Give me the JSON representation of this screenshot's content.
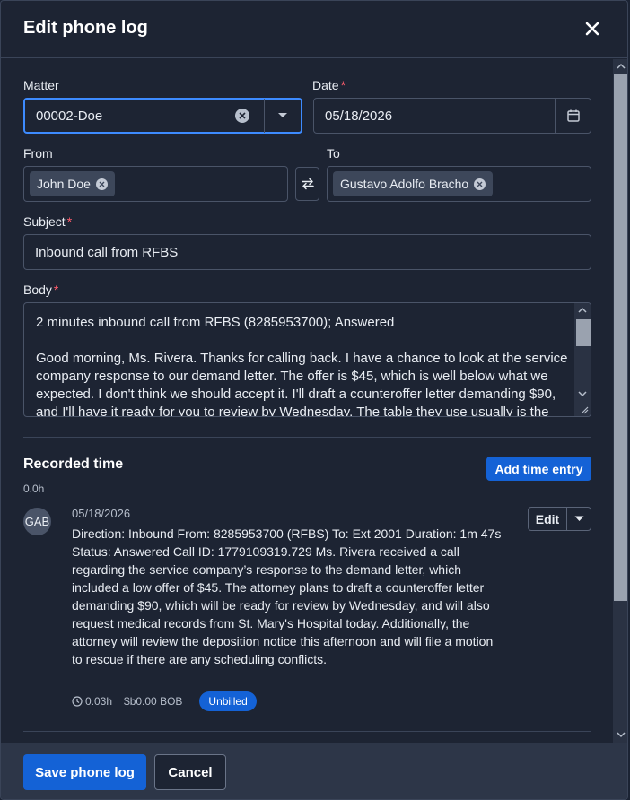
{
  "modal": {
    "title": "Edit phone log",
    "close_icon": "close-icon"
  },
  "form": {
    "matter": {
      "label": "Matter",
      "value": "00002-Doe"
    },
    "date": {
      "label": "Date",
      "required_mark": "*",
      "value": "05/18/2026"
    },
    "from": {
      "label": "From",
      "chips": [
        "John Doe"
      ]
    },
    "to": {
      "label": "To",
      "chips": [
        "Gustavo Adolfo Bracho"
      ]
    },
    "subject": {
      "label": "Subject",
      "required_mark": "*",
      "value": "Inbound call from RFBS"
    },
    "body": {
      "label": "Body",
      "required_mark": "*",
      "value": "2 minutes inbound call from RFBS (8285953700); Answered\n\nGood morning, Ms. Rivera. Thanks for calling back. I have a chance to look at the service company response to our demand letter. The offer is $45, which is well below what we expected. I don't think we should accept it. I'll draft a counteroffer letter demanding $90, and I'll have it ready for you to review by Wednesday. The table they use usually is the"
    }
  },
  "recorded_time": {
    "title": "Recorded time",
    "total": "0.0h",
    "add_button": "Add time entry",
    "entries": [
      {
        "avatar": "GAB",
        "date": "05/18/2026",
        "description": "Direction: Inbound From: 8285953700 (RFBS) To: Ext 2001 Duration: 1m 47s Status: Answered Call ID: 1779109319.729 Ms. Rivera received a call regarding the service company’s response to the demand letter, which included a low offer of $45. The attorney plans to draft a counteroffer letter demanding $90, which will be ready for review by Wednesday, and will also request medical records from St. Mary's Hospital today. Additionally, the attorney will review the deposition notice this afternoon and will file a motion to rescue if there are any scheduling conflicts.",
        "hours": "0.03h",
        "amount": "$b0.00 BOB",
        "status": "Unbilled",
        "edit_label": "Edit"
      }
    ]
  },
  "footer": {
    "save_label": "Save phone log",
    "cancel_label": "Cancel"
  },
  "colors": {
    "primary": "#1462d6",
    "focus": "#3d8bff",
    "required": "#ff5c6c",
    "background": "#1d2433"
  }
}
